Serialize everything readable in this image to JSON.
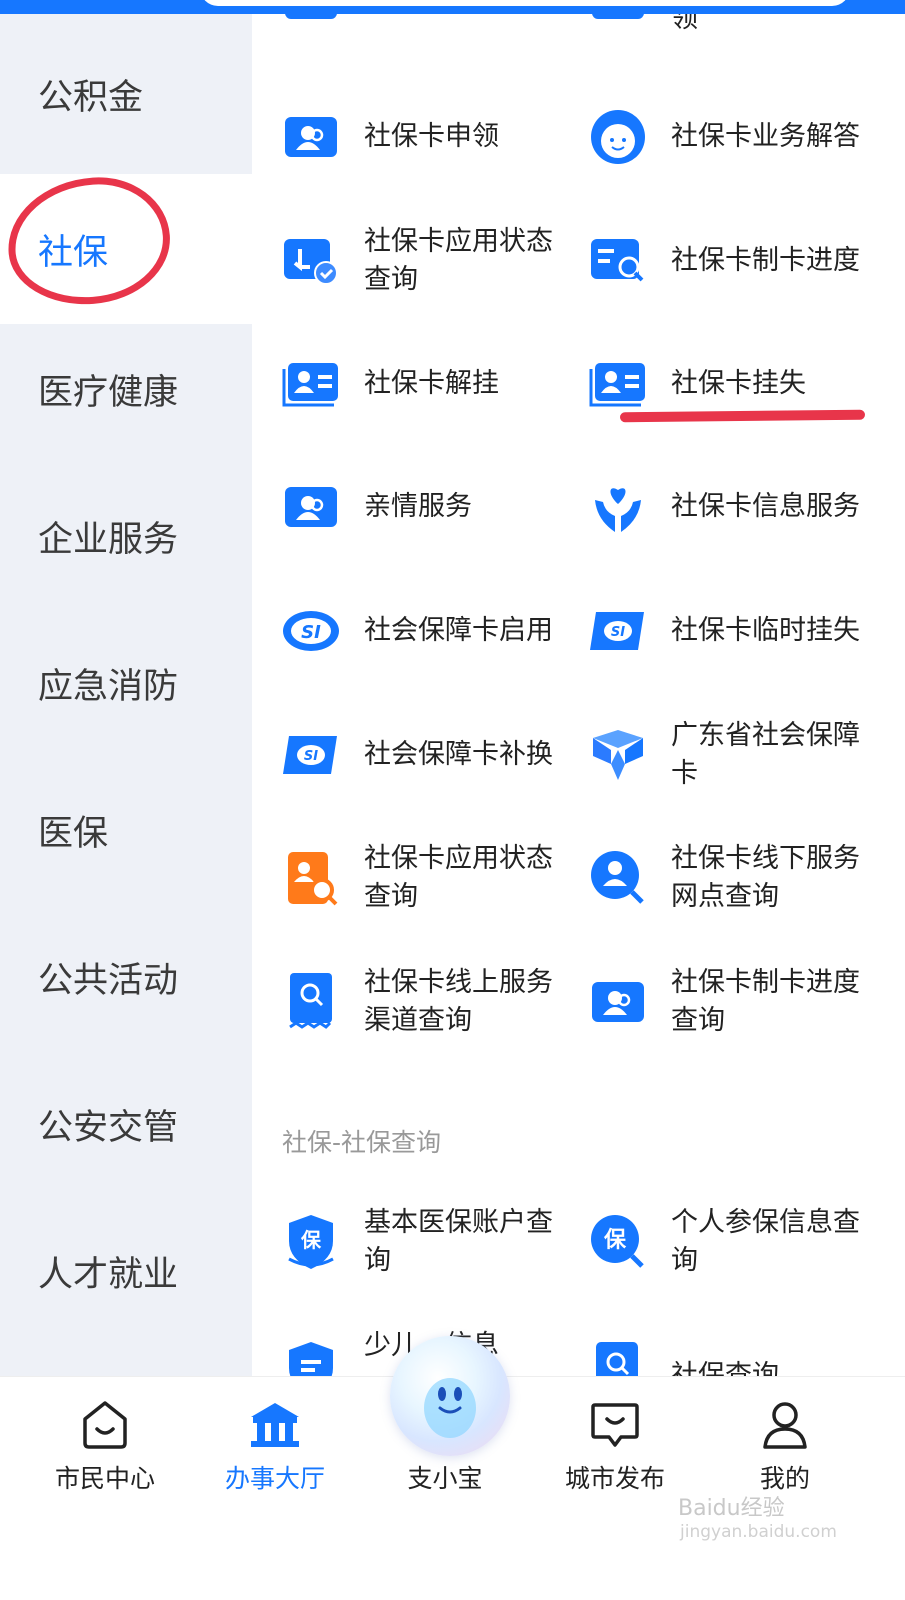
{
  "sidebar": {
    "items": [
      {
        "label": "公积金"
      },
      {
        "label": "社保",
        "active": true
      },
      {
        "label": "医疗健康"
      },
      {
        "label": "企业服务"
      },
      {
        "label": "应急消防"
      },
      {
        "label": "医保"
      },
      {
        "label": "公共活动"
      },
      {
        "label": "公安交管"
      },
      {
        "label": "人才就业"
      }
    ]
  },
  "services": [
    {
      "label": "社保卡申领",
      "icon": "user-card-icon"
    },
    {
      "label": "社保卡业务解答",
      "icon": "customer-service-icon"
    },
    {
      "label": "社保卡应用状态查询",
      "icon": "hand-check-icon"
    },
    {
      "label": "社保卡制卡进度",
      "icon": "card-search-icon"
    },
    {
      "label": "社保卡解挂",
      "icon": "id-card-icon"
    },
    {
      "label": "社保卡挂失",
      "icon": "id-card-icon"
    },
    {
      "label": "亲情服务",
      "icon": "user-card-icon"
    },
    {
      "label": "社保卡信息服务",
      "icon": "heart-hands-icon"
    },
    {
      "label": "社会保障卡启用",
      "icon": "si-logo-icon"
    },
    {
      "label": "社保卡临时挂失",
      "icon": "si-card-icon"
    },
    {
      "label": "社会保障卡补换",
      "icon": "si-card-icon"
    },
    {
      "label": "广东省社会保障卡",
      "icon": "cube-logo-icon"
    },
    {
      "label": "社保卡应用状态查询",
      "icon": "orange-card-search-icon"
    },
    {
      "label": "社保卡线下服务网点查询",
      "icon": "person-search-icon"
    },
    {
      "label": "社保卡线上服务渠道查询",
      "icon": "receipt-search-icon"
    },
    {
      "label": "社保卡制卡进度查询",
      "icon": "user-card-icon"
    },
    {
      "label": "基本医保账户查询",
      "icon": "bao-shield-icon"
    },
    {
      "label": "个人参保信息查询",
      "icon": "bao-search-icon"
    },
    {
      "label": "少儿…信息",
      "icon": "doc-icon"
    },
    {
      "label": "社保查询",
      "icon": "search-doc-icon"
    }
  ],
  "partial_top": {
    "right_label_tail": "领"
  },
  "section": {
    "title": "社保-社保查询"
  },
  "bottom_nav": {
    "tabs": [
      {
        "label": "市民中心",
        "icon": "smile-box-icon"
      },
      {
        "label": "办事大厅",
        "icon": "bank-icon",
        "active": true
      },
      {
        "label": "支小宝",
        "icon": "mascot-icon"
      },
      {
        "label": "城市发布",
        "icon": "chat-box-icon"
      },
      {
        "label": "我的",
        "icon": "person-icon"
      }
    ]
  },
  "watermark": {
    "text": "Baidu经验",
    "sub": "jingyan.baidu.com"
  },
  "colors": {
    "accent": "#1677ff",
    "highlight": "#e8354a",
    "orange": "#ff7a1a"
  }
}
